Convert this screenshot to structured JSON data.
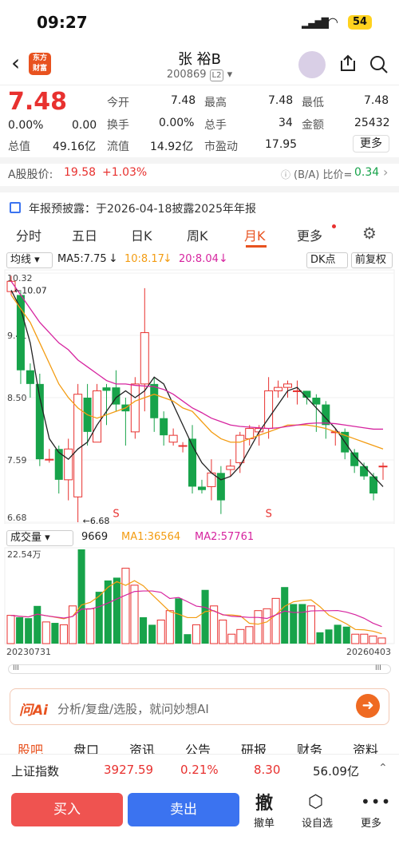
{
  "status": {
    "time": "09:27",
    "battery": "54"
  },
  "header": {
    "logo": "东方财富",
    "name": "张 裕B",
    "code": "200869",
    "level": "L2"
  },
  "quote": {
    "price": "7.48",
    "pct": "0.00%",
    "chg": "0.00",
    "rows": [
      [
        {
          "l": "今开",
          "v": "7.48"
        },
        {
          "l": "最高",
          "v": "7.48"
        },
        {
          "l": "最低",
          "v": "7.48"
        }
      ],
      [
        {
          "l": "换手",
          "v": "0.00%"
        },
        {
          "l": "总手",
          "v": "34"
        },
        {
          "l": "金额",
          "v": "25432"
        }
      ],
      [
        {
          "l": "流值",
          "v": "14.92亿"
        },
        {
          "l": "市盈动",
          "v": "17.95"
        }
      ]
    ],
    "mcap_label": "总值",
    "mcap": "49.16亿",
    "more": "更多"
  },
  "ashare": {
    "label": "A股股价:",
    "price": "19.58",
    "pct": "+1.03%",
    "ratio_label": "(B/A) 比价=",
    "ratio": "0.34"
  },
  "notice": "年报预披露：于2026-04-18披露2025年年报",
  "tabs": [
    "分时",
    "五日",
    "日K",
    "周K",
    "月K",
    "更多"
  ],
  "indicator": {
    "ma_sel": "均线",
    "ma5": "MA5:7.75",
    "ma10": "10:8.17",
    "ma20": "20:8.04",
    "dk": "DK点",
    "fq": "前复权"
  },
  "chart_data": {
    "type": "candlestick",
    "y_ticks": [
      "10.32",
      "9.41",
      "8.50",
      "7.59",
      "6.68"
    ],
    "high_label": "10.07",
    "low_label": "6.68",
    "candles": [
      [
        10.05,
        10.2,
        10.0,
        10.28
      ],
      [
        10.0,
        8.9,
        8.7,
        10.05
      ],
      [
        8.9,
        8.7,
        8.5,
        9.0
      ],
      [
        8.7,
        7.6,
        7.5,
        8.85
      ],
      [
        7.6,
        7.6,
        7.55,
        7.75
      ],
      [
        7.75,
        7.3,
        7.1,
        7.8
      ],
      [
        7.3,
        7.75,
        7.0,
        7.9
      ],
      [
        7.05,
        8.55,
        6.68,
        8.7
      ],
      [
        8.5,
        8.0,
        7.8,
        8.7
      ],
      [
        7.85,
        8.6,
        7.9,
        8.7
      ],
      [
        8.65,
        8.6,
        8.1,
        8.7
      ],
      [
        8.65,
        8.4,
        8.3,
        8.9
      ],
      [
        8.4,
        8.3,
        7.8,
        8.5
      ],
      [
        8.0,
        8.7,
        7.9,
        8.8
      ],
      [
        8.7,
        9.45,
        8.3,
        10.1
      ],
      [
        8.7,
        8.2,
        8.0,
        8.8
      ],
      [
        8.2,
        7.95,
        7.8,
        8.3
      ],
      [
        7.85,
        7.95,
        7.8,
        8.05
      ],
      [
        7.8,
        7.8,
        7.7,
        7.85
      ],
      [
        7.9,
        7.2,
        7.1,
        8.1
      ],
      [
        7.2,
        7.15,
        7.1,
        7.3
      ],
      [
        7.2,
        7.4,
        7.0,
        7.6
      ],
      [
        7.4,
        7.0,
        6.8,
        7.5
      ],
      [
        7.45,
        7.5,
        7.35,
        7.6
      ],
      [
        7.55,
        7.95,
        7.4,
        8.0
      ],
      [
        7.9,
        8.05,
        7.8,
        8.1
      ],
      [
        8.0,
        8.05,
        7.8,
        8.1
      ],
      [
        8.05,
        8.6,
        7.9,
        8.8
      ],
      [
        8.6,
        8.65,
        8.5,
        8.75
      ],
      [
        8.65,
        8.7,
        8.5,
        8.75
      ],
      [
        8.6,
        8.6,
        8.4,
        8.75
      ],
      [
        8.6,
        8.5,
        8.4,
        8.6
      ],
      [
        8.5,
        8.4,
        8.0,
        8.55
      ],
      [
        8.4,
        8.1,
        7.9,
        8.45
      ],
      [
        8.0,
        8.0,
        7.8,
        8.05
      ],
      [
        8.0,
        7.7,
        7.6,
        8.05
      ],
      [
        7.7,
        7.5,
        7.4,
        7.75
      ],
      [
        7.5,
        7.35,
        7.3,
        7.55
      ],
      [
        7.35,
        7.1,
        7.0,
        7.4
      ],
      [
        7.5,
        7.5,
        7.3,
        7.55
      ]
    ],
    "ma5": [
      10.07,
      9.8,
      9.3,
      8.5,
      7.9,
      7.7,
      7.6,
      7.75,
      7.85,
      8.1,
      8.3,
      8.5,
      8.6,
      8.5,
      8.6,
      8.8,
      8.7,
      8.4,
      8.1,
      7.8,
      7.55,
      7.4,
      7.3,
      7.35,
      7.5,
      7.75,
      8.0,
      8.2,
      8.4,
      8.6,
      8.65,
      8.5,
      8.35,
      8.2,
      8.05,
      7.85,
      7.65,
      7.5,
      7.35,
      7.2
    ],
    "ma10": [
      10.0,
      9.8,
      9.6,
      9.3,
      9.0,
      8.7,
      8.5,
      8.35,
      8.25,
      8.2,
      8.25,
      8.3,
      8.35,
      8.45,
      8.5,
      8.55,
      8.5,
      8.45,
      8.35,
      8.3,
      8.15,
      8.0,
      7.9,
      7.85,
      7.85,
      7.9,
      7.95,
      8.0,
      8.05,
      8.1,
      8.1,
      8.1,
      8.08,
      8.05,
      8.0,
      7.95,
      7.9,
      7.85,
      7.8,
      7.75
    ],
    "ma20": [
      10.2,
      10.0,
      9.8,
      9.6,
      9.45,
      9.3,
      9.2,
      9.05,
      8.95,
      8.85,
      8.75,
      8.7,
      8.7,
      8.68,
      8.67,
      8.66,
      8.62,
      8.55,
      8.45,
      8.35,
      8.28,
      8.2,
      8.15,
      8.1,
      8.08,
      8.07,
      8.06,
      8.05,
      8.06,
      8.08,
      8.1,
      8.12,
      8.13,
      8.13,
      8.12,
      8.1,
      8.08,
      8.06,
      8.04,
      8.04
    ]
  },
  "volume": {
    "sel": "成交量",
    "vol": "9669",
    "ma1": "MA1:36564",
    "ma2": "MA2:57761",
    "max": "22.54万",
    "start": "20230731",
    "end": "20260403",
    "bars": [
      0.3,
      0.28,
      0.27,
      0.4,
      0.23,
      0.22,
      0.2,
      0.4,
      1.0,
      0.37,
      0.55,
      0.67,
      0.7,
      0.8,
      0.62,
      0.28,
      0.2,
      0.25,
      0.35,
      0.48,
      0.1,
      0.2,
      0.57,
      0.4,
      0.25,
      0.1,
      0.15,
      0.18,
      0.35,
      0.37,
      0.48,
      0.6,
      0.42,
      0.42,
      0.4,
      0.12,
      0.15,
      0.2,
      0.18,
      0.1,
      0.1,
      0.08,
      0.06
    ]
  },
  "ai": {
    "brand": "问Ai",
    "placeholder": "分析/复盘/选股，就问妙想AI"
  },
  "bottomtabs": [
    "股吧",
    "盘口",
    "资讯",
    "公告",
    "研报",
    "财务",
    "资料"
  ],
  "index": {
    "name": "上证指数",
    "value": "3927.59",
    "pct": "0.21%",
    "chg": "8.30",
    "amount": "56.09亿"
  },
  "actions": {
    "buy": "买入",
    "sell": "卖出",
    "cancel": "撤单",
    "cancel_icon": "撤",
    "custom": "设自选",
    "more": "更多"
  },
  "colors": {
    "up": "#e8312f",
    "down": "#17a34a",
    "accent": "#e8521f",
    "sell": "#3b73f0"
  }
}
